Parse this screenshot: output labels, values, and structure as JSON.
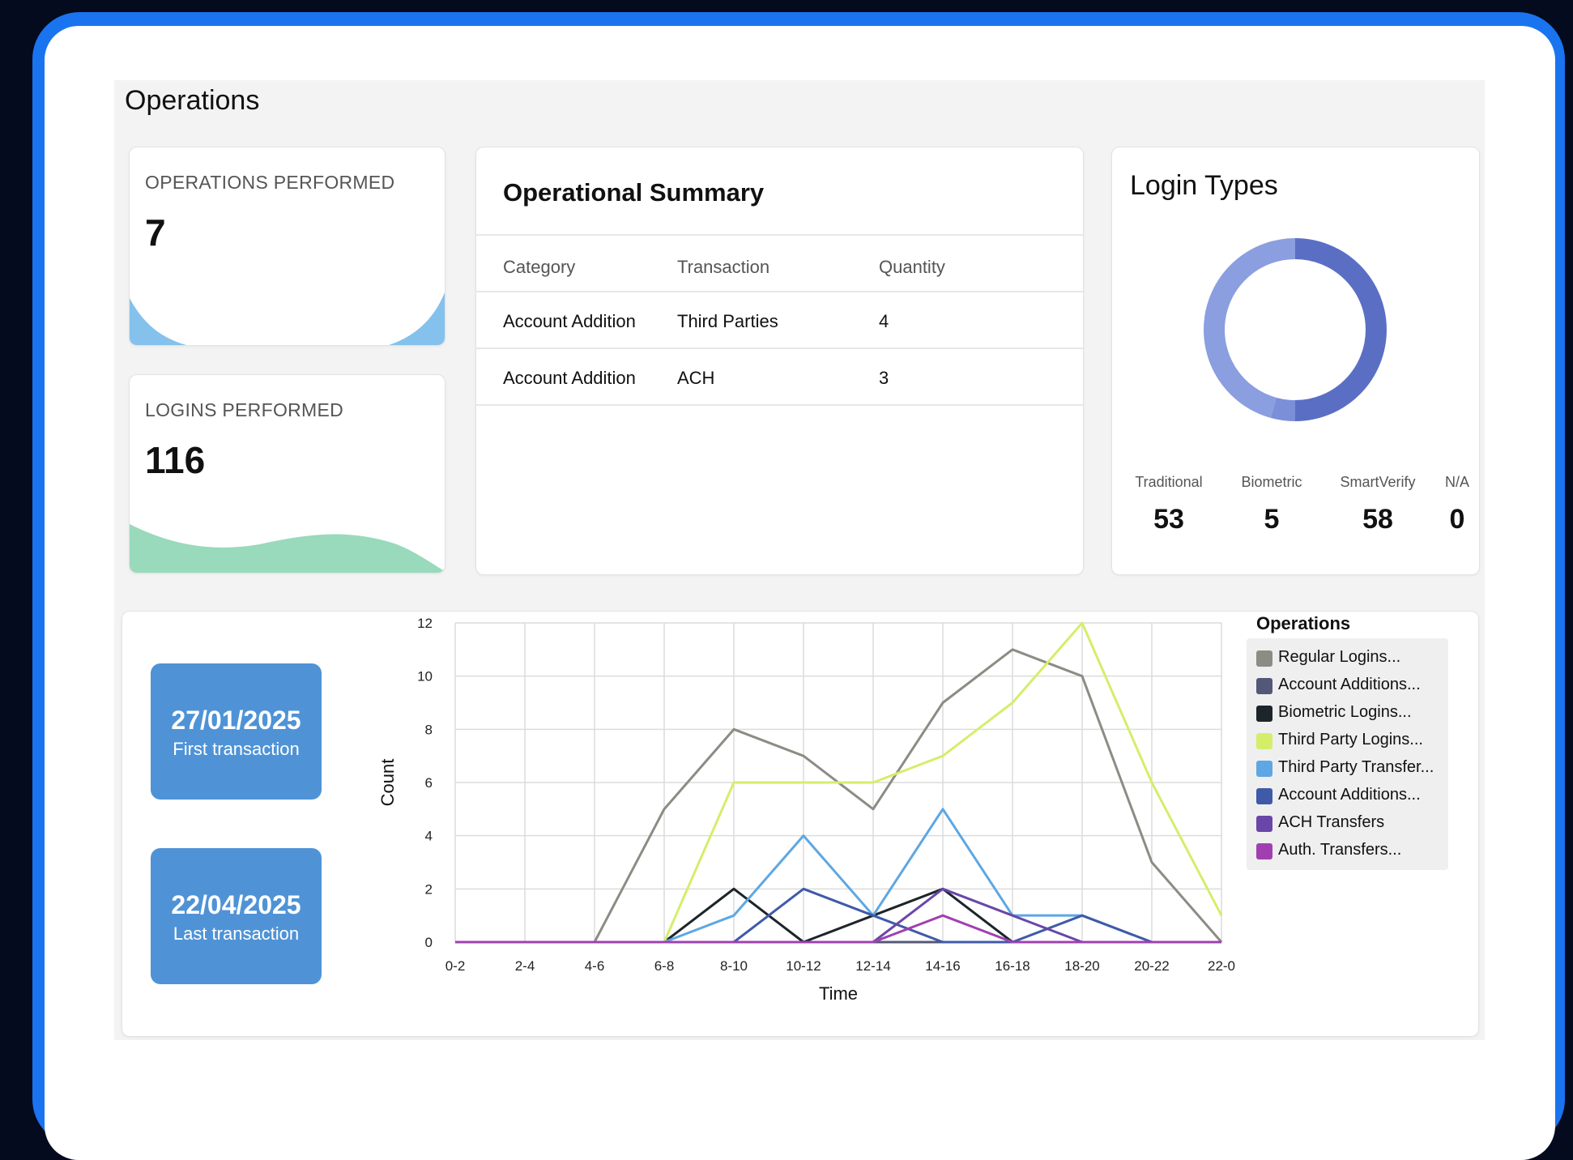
{
  "dashboard": {
    "title": "Operations"
  },
  "kpis": {
    "operations": {
      "label": "OPERATIONS PERFORMED",
      "value": "7"
    },
    "logins": {
      "label": "LOGINS PERFORMED",
      "value": "116"
    }
  },
  "summary": {
    "title": "Operational Summary",
    "headers": [
      "Category",
      "Transaction",
      "Quantity"
    ],
    "rows": [
      [
        "Account Addition",
        "Third Parties",
        "4"
      ],
      [
        "Account Addition",
        "ACH",
        "3"
      ]
    ]
  },
  "login_types": {
    "title": "Login Types",
    "stats": [
      {
        "label": "Traditional",
        "value": "53"
      },
      {
        "label": "Biometric",
        "value": "5"
      },
      {
        "label": "SmartVerify",
        "value": "58"
      },
      {
        "label": "N/A",
        "value": "0"
      }
    ],
    "colors": [
      "#8a9ee0",
      "#5a6fc4"
    ]
  },
  "dates": {
    "first": {
      "value": "27/01/2025",
      "label": "First transaction"
    },
    "last": {
      "value": "22/04/2025",
      "label": "Last transaction"
    }
  },
  "chart_data": [
    {
      "type": "pie",
      "title": "Login Types",
      "categories": [
        "Traditional",
        "Biometric",
        "SmartVerify",
        "N/A"
      ],
      "values": [
        53,
        5,
        58,
        0
      ],
      "colors": [
        "#8a9ee0",
        "#7a8fd8",
        "#5a6fc4",
        "#cccccc"
      ],
      "donut": true
    },
    {
      "type": "line",
      "title": "",
      "xlabel": "Time",
      "ylabel": "Count",
      "ylim": [
        0,
        12
      ],
      "yticks": [
        0,
        2,
        4,
        6,
        8,
        10,
        12
      ],
      "grid": true,
      "legend_title": "Operations",
      "legend_position": "right",
      "x": [
        "0-2",
        "2-4",
        "4-6",
        "6-8",
        "8-10",
        "10-12",
        "12-14",
        "14-16",
        "16-18",
        "18-20",
        "20-22",
        "22-0"
      ],
      "series": [
        {
          "name": "Regular Logins...",
          "color": "#8c8c84",
          "values": [
            0,
            0,
            0,
            5,
            8,
            7,
            5,
            9,
            11,
            10,
            3,
            0
          ]
        },
        {
          "name": "Account Additions...",
          "color": "#545878",
          "values": [
            0,
            0,
            0,
            0,
            0,
            0,
            0,
            0,
            0,
            0,
            0,
            0
          ]
        },
        {
          "name": "Biometric Logins...",
          "color": "#1c2529",
          "values": [
            0,
            0,
            0,
            0,
            2,
            0,
            1,
            2,
            0,
            0,
            0,
            0
          ]
        },
        {
          "name": "Third Party Logins...",
          "color": "#d4ee6a",
          "values": [
            0,
            0,
            0,
            0,
            6,
            6,
            6,
            7,
            9,
            12,
            6,
            1
          ]
        },
        {
          "name": "Third Party Transfer...",
          "color": "#5ea7e2",
          "values": [
            0,
            0,
            0,
            0,
            1,
            4,
            1,
            5,
            1,
            1,
            0,
            0
          ]
        },
        {
          "name": "Account Additions...",
          "color": "#3f5aa8",
          "values": [
            0,
            0,
            0,
            0,
            0,
            2,
            1,
            0,
            0,
            1,
            0,
            0
          ]
        },
        {
          "name": "ACH Transfers",
          "color": "#6947a8",
          "values": [
            0,
            0,
            0,
            0,
            0,
            0,
            0,
            2,
            1,
            0,
            0,
            0
          ]
        },
        {
          "name": "Auth. Transfers...",
          "color": "#a040b0",
          "values": [
            0,
            0,
            0,
            0,
            0,
            0,
            0,
            1,
            0,
            0,
            0,
            0
          ]
        }
      ]
    }
  ]
}
